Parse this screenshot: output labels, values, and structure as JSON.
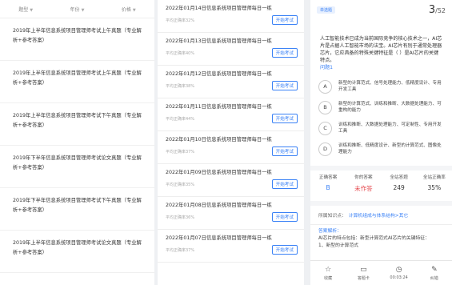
{
  "filters": [
    {
      "label": "题型"
    },
    {
      "label": "年份"
    },
    {
      "label": "价格"
    }
  ],
  "papers": [
    "2019年上半年信息系统项目管理师考试上午真题（专业解析+参考答案）",
    "2019年上半年信息系统项目管理师考试上午真题（专业解析+参考答案）",
    "2019年上半年信息系统项目管理师考试下午真题（专业解析+参考答案）",
    "2019年下半年信息系统项目管理师考试论文真题（专业解析+参考答案）",
    "2019年下半年信息系统项目管理师考试下午真题（专业解析+参考答案）",
    "2019年上半年信息系统项目管理师考试论文真题（专业解析+参考答案）"
  ],
  "exams": [
    {
      "title": "2022年01月14日信息系统项目管理师每日一练",
      "score": "平均正确率32%",
      "button": "开始考试"
    },
    {
      "title": "2022年01月13日信息系统项目管理师每日一练",
      "score": "平均正确率40%",
      "button": "开始考试"
    },
    {
      "title": "2022年01月12日信息系统项目管理师每日一练",
      "score": "平均正确率38%",
      "button": "开始考试"
    },
    {
      "title": "2022年01月11日信息系统项目管理师每日一练",
      "score": "平均正确率44%",
      "button": "开始考试"
    },
    {
      "title": "2022年01月10日信息系统项目管理师每日一练",
      "score": "平均正确率37%",
      "button": "开始考试"
    },
    {
      "title": "2022年01月09日信息系统项目管理师每日一练",
      "score": "平均正确率35%",
      "button": "开始考试"
    },
    {
      "title": "2022年01月08日信息系统项目管理师每日一练",
      "score": "平均正确率36%",
      "button": "开始考试"
    },
    {
      "title": "2022年01月07日信息系统项目管理师每日一练",
      "score": "平均正确率37%",
      "button": "开始考试"
    }
  ],
  "question": {
    "type": "单选题",
    "current": "3",
    "total": "/52",
    "stem": "人工智能技术已成为当前国际竞争的核心技术之一，AI芯片是占据人工智能市场的法宝。AI芯片有别于通常处理器芯片，它应具备的特殊关键特征是（    ）是AI芯片的关键特点。",
    "ask": "问题1",
    "options": [
      {
        "letter": "A",
        "text": "新型的计算范式、信号处理能力、低精度设计、专用开发工具"
      },
      {
        "letter": "B",
        "text": "新型的计算范式、训练和推断、大数据处理能力、可重构的能力"
      },
      {
        "letter": "C",
        "text": "训练和推断、大数据处理能力、可定制性、专用开发工具"
      },
      {
        "letter": "D",
        "text": "训练和推断、低精度设计、新型的计算范式、图像处理能力"
      }
    ]
  },
  "stats": [
    {
      "label": "正确答案",
      "value": "B"
    },
    {
      "label": "你的答案",
      "value": "未作答"
    },
    {
      "label": "全站答题",
      "value": "249"
    },
    {
      "label": "全站正确率",
      "value": "35%"
    }
  ],
  "knowledge_point": {
    "label": "所属知识点：",
    "text": "计算机组成与体系结构>其它"
  },
  "analysis": {
    "title": "答案解析：",
    "lines": [
      "AI芯片的特点包括：新型计算范式AI芯片的关键特征：",
      "1、新型的计算范式"
    ]
  },
  "bottom_bar": [
    {
      "label": "收藏",
      "icon": "star-icon"
    },
    {
      "label": "答题卡",
      "icon": "card-icon"
    },
    {
      "label": "00:03:24",
      "icon": "clock-icon"
    },
    {
      "label": "纠错",
      "icon": "edit-icon"
    }
  ]
}
